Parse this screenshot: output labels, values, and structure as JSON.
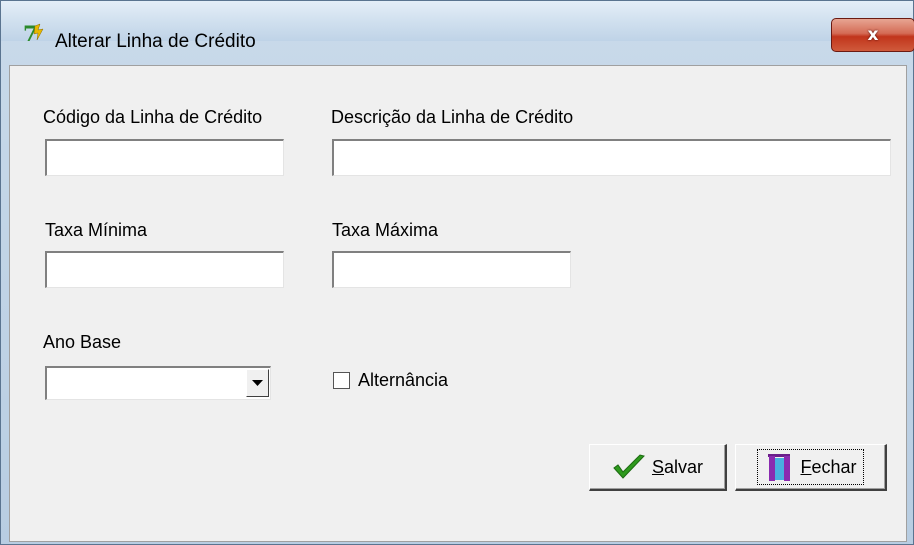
{
  "window": {
    "title": "Alterar Linha de Crédito",
    "close_glyph": "x"
  },
  "form": {
    "codigo": {
      "label": "Código da Linha de Crédito",
      "value": ""
    },
    "descricao": {
      "label": "Descrição da Linha de Crédito",
      "value": ""
    },
    "taxa_minima": {
      "label": "Taxa Mínima",
      "value": ""
    },
    "taxa_maxima": {
      "label": "Taxa Máxima",
      "value": ""
    },
    "ano_base": {
      "label": "Ano Base",
      "selected": ""
    },
    "alternancia": {
      "label": "Alternância",
      "checked": false
    }
  },
  "buttons": {
    "salvar": {
      "mnemonic": "S",
      "rest": "alvar",
      "icon": "checkmark-icon"
    },
    "fechar": {
      "mnemonic": "F",
      "rest": "echar",
      "icon": "door-exit-icon"
    }
  },
  "colors": {
    "close_button": "#c1351c",
    "check_green": "#2e9a1d",
    "client_bg": "#f0f0f0"
  }
}
